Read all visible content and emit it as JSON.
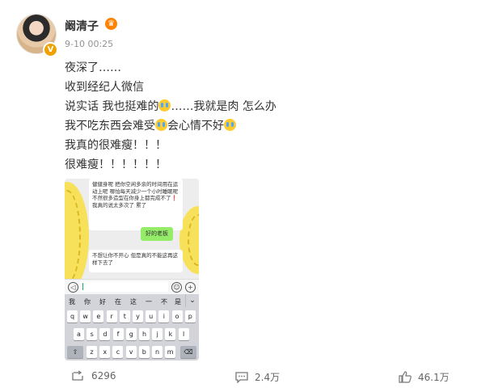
{
  "post": {
    "author": "阚清子",
    "time": "9-10 00:25",
    "lines": [
      "夜深了……",
      "收到经纪人微信",
      "说实话 我也挺难的",
      "……我就是肉 怎么办",
      "我不吃东西会难受",
      "会心情不好",
      "我真的很难瘦！！！",
      "很难瘦！！！！！！"
    ]
  },
  "screenshot": {
    "msg1": "健健身呢 把你空闲多余的时间用在运动上呢 哪怕每天减少一个小时睡眠呢 不然很多造型在你身上都完成不了❗ 我真的说太多次了 累了",
    "reply": "好的老板",
    "msg2": "不想让你不开心 但是真的不能这再这样下去了",
    "candidates": [
      "我",
      "你",
      "好",
      "在",
      "这",
      "一",
      "不",
      "是"
    ],
    "keyrow1": [
      "q",
      "w",
      "e",
      "r",
      "t",
      "y",
      "u",
      "i",
      "o",
      "p"
    ],
    "keyrow2": [
      "a",
      "s",
      "d",
      "f",
      "g",
      "h",
      "j",
      "k",
      "l"
    ],
    "keyrow3": [
      "z",
      "x",
      "c",
      "v",
      "b",
      "n",
      "m"
    ]
  },
  "actions": {
    "repost": "6296",
    "comments": "2.4万",
    "likes": "46.1万"
  },
  "colors": {
    "badge": "#f0a100",
    "wechat_green": "#95ec69",
    "sticker_yellow": "#f7e15a"
  },
  "icons": [
    "repost-icon",
    "comment-icon",
    "like-icon",
    "crown-icon",
    "crying-emoji-icon"
  ]
}
